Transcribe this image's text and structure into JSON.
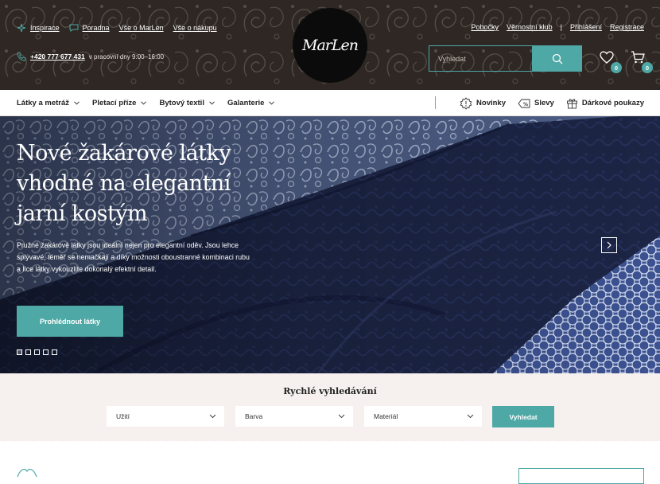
{
  "header": {
    "top_links": [
      {
        "label": "Inspirace",
        "icon": "sparkle-icon"
      },
      {
        "label": "Poradna",
        "icon": "chat-icon"
      },
      {
        "label": "Vše o MarLen",
        "icon": ""
      },
      {
        "label": "Vše o nákupu",
        "icon": ""
      }
    ],
    "phone": "+420 777 677 431",
    "hours": "v pracovní dny 9:00–16:00",
    "logo_text": "MarLen",
    "right_links": {
      "branches": "Pobočky",
      "loyalty": "Věrnostní klub",
      "separator": "|",
      "login": "Přihlášení",
      "register": "Registrace"
    },
    "search": {
      "placeholder": "Vyhledat"
    },
    "wishlist_count": "0",
    "cart_count": "0"
  },
  "nav": {
    "categories": [
      "Látky a metráž",
      "Pletací příze",
      "Bytový textil",
      "Galanterie"
    ],
    "extras": [
      {
        "label": "Novinky",
        "icon": "new-badge-icon"
      },
      {
        "label": "Slevy",
        "icon": "discount-tag-icon"
      },
      {
        "label": "Dárkové poukazy",
        "icon": "gift-icon"
      }
    ]
  },
  "hero": {
    "title": "Nové žakárové látky vhodné na elegantní jarní kostým",
    "text": "Pružné žakárové látky jsou ideální nejen pro elegantní oděv. Jsou lehce splývavé, téměř se nemačkají a díky možnosti oboustranné kombinaci rubu a líce látky vykouzlíte dokonalý efektní detail.",
    "cta": "Prohlédnout látky",
    "slides": 5,
    "active_slide": 1
  },
  "quick_search": {
    "title": "Rychlé vyhledávání",
    "filters": [
      "Užití",
      "Barva",
      "Materiál"
    ],
    "button": "Vyhledat"
  },
  "colors": {
    "accent": "#4ea8a5",
    "header_bg": "#2e2723",
    "quick_bg": "#f6f1ee"
  }
}
